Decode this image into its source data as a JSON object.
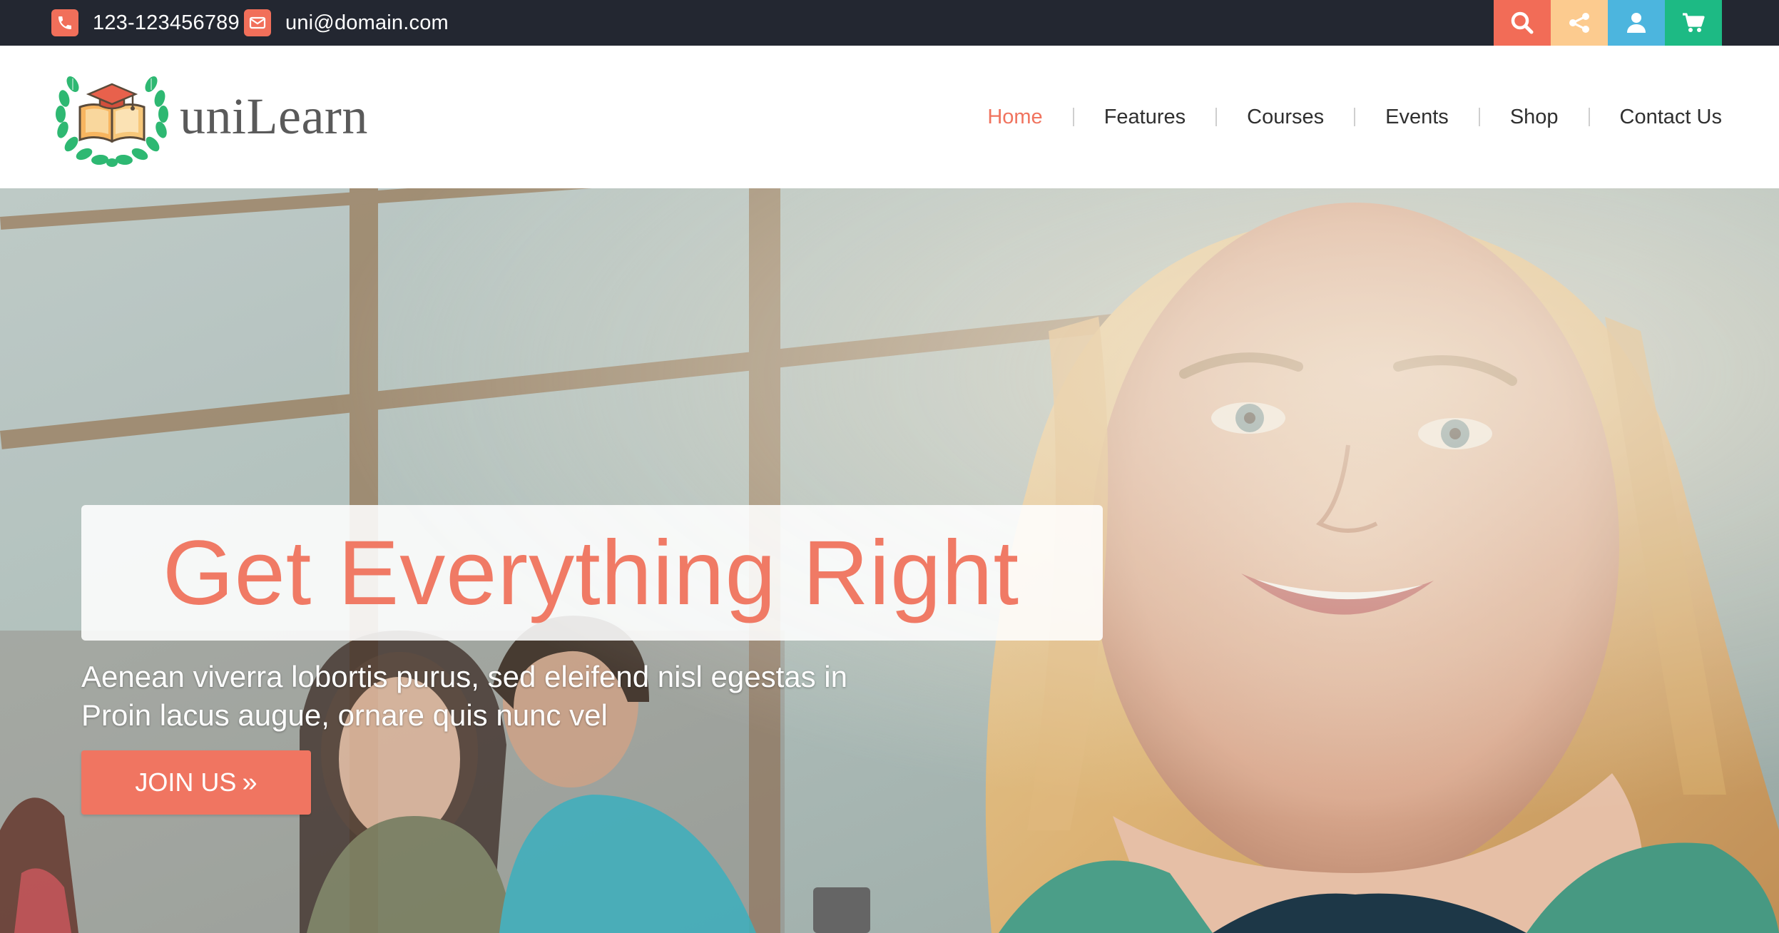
{
  "topbar": {
    "phone": "123-123456789",
    "email": "uni@domain.com",
    "phone_icon": "phone-icon",
    "email_icon": "envelope-icon",
    "quick_buttons": [
      {
        "icon": "search-icon",
        "color": "#f26c57"
      },
      {
        "icon": "share-icon",
        "color": "#fccb8f"
      },
      {
        "icon": "user-icon",
        "color": "#4cb5de"
      },
      {
        "icon": "cart-icon",
        "color": "#1dba84"
      }
    ]
  },
  "header": {
    "logo_text": "uniLearn",
    "logo_icon": "graduation-book-wreath-logo",
    "nav": [
      {
        "label": "Home",
        "active": true
      },
      {
        "label": "Features",
        "active": false
      },
      {
        "label": "Courses",
        "active": false
      },
      {
        "label": "Events",
        "active": false
      },
      {
        "label": "Shop",
        "active": false
      },
      {
        "label": "Contact Us",
        "active": false
      }
    ]
  },
  "hero": {
    "headline": "Get Everything Right",
    "subtext_line1": "Aenean viverra lobortis purus, sed eleifend nisl egestas in",
    "subtext_line2": "Proin lacus augue, ornare quis nunc vel",
    "cta_label": "JOIN US",
    "cta_icon": "double-chevron-right-icon"
  },
  "colors": {
    "accent": "#f07561",
    "topbar_bg": "#232731",
    "nav_text": "#2f2f2f",
    "logo_green": "#2eb872"
  }
}
